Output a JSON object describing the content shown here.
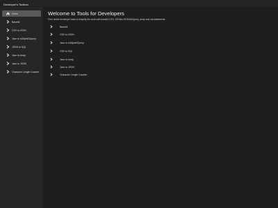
{
  "app": {
    "title": "Developer's Toolbox"
  },
  "sidebar": {
    "items": [
      {
        "label": "Home",
        "icon": "home-icon"
      },
      {
        "label": "Base64",
        "icon": "chevron-right-icon"
      },
      {
        "label": "CSV to JSON",
        "icon": "chevron-right-icon"
      },
      {
        "label": "Json to sObjectSQuery",
        "icon": "chevron-right-icon"
      },
      {
        "label": "JSON to SQL",
        "icon": "chevron-right-icon"
      },
      {
        "label": "Json to Array",
        "icon": "chevron-right-icon"
      },
      {
        "label": "Json to JSON",
        "icon": "chevron-right-icon"
      },
      {
        "label": "Character Length Counter",
        "icon": "chevron-right-icon"
      }
    ]
  },
  "main": {
    "title": "Welcome to Tools for Developers",
    "subtitle": "Free online developer tools to simplify the work with base64,CSV, JSONtoJSONtoSQuery, array and sql statements",
    "tools": [
      {
        "label": "Base64"
      },
      {
        "label": "CSV to JSON"
      },
      {
        "label": "Json to sObjectSQuery"
      },
      {
        "label": "CSV to SQL"
      },
      {
        "label": "Json to Array"
      },
      {
        "label": "Json to JSON"
      },
      {
        "label": "Character Length Counter"
      }
    ]
  },
  "colors": {
    "background": "#1e1e1e",
    "sidebar": "#262626",
    "active_item": "#5a5a5a",
    "text": "#e6e6e6"
  }
}
